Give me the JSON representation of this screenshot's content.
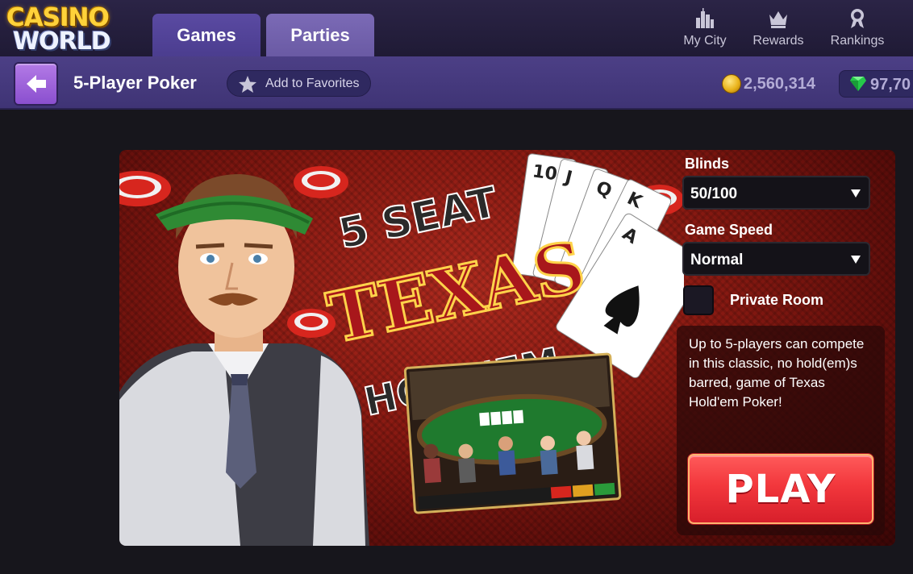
{
  "brand": {
    "line1": "CASINO",
    "line2": "WORLD"
  },
  "tabs": [
    {
      "label": "Games",
      "active": true
    },
    {
      "label": "Parties",
      "active": false
    }
  ],
  "nav": [
    {
      "label": "My City",
      "icon": "city-icon"
    },
    {
      "label": "Rewards",
      "icon": "crown-icon"
    },
    {
      "label": "Rankings",
      "icon": "medal-icon"
    }
  ],
  "subbar": {
    "title": "5-Player Poker",
    "favorite_label": "Add to Favorites",
    "coins": "2,560,314",
    "gems": "97,70"
  },
  "game": {
    "art_title_line1": "5 SEAT",
    "art_title_line2": "TEXAS",
    "art_title_line3": "HOLD'EM",
    "cards": [
      "10",
      "J",
      "Q",
      "K",
      "A"
    ],
    "blinds_label": "Blinds",
    "blinds_value": "50/100",
    "speed_label": "Game Speed",
    "speed_value": "Normal",
    "private_label": "Private Room",
    "private_checked": false,
    "description": "Up to 5-players can compete in this classic, no hold(em)s barred, game of Texas Hold'em Poker!",
    "play_label": "PLAY"
  },
  "colors": {
    "accent_purple": "#4b3d8f",
    "play_red": "#f2373c",
    "panel_red": "#8a1a12"
  }
}
